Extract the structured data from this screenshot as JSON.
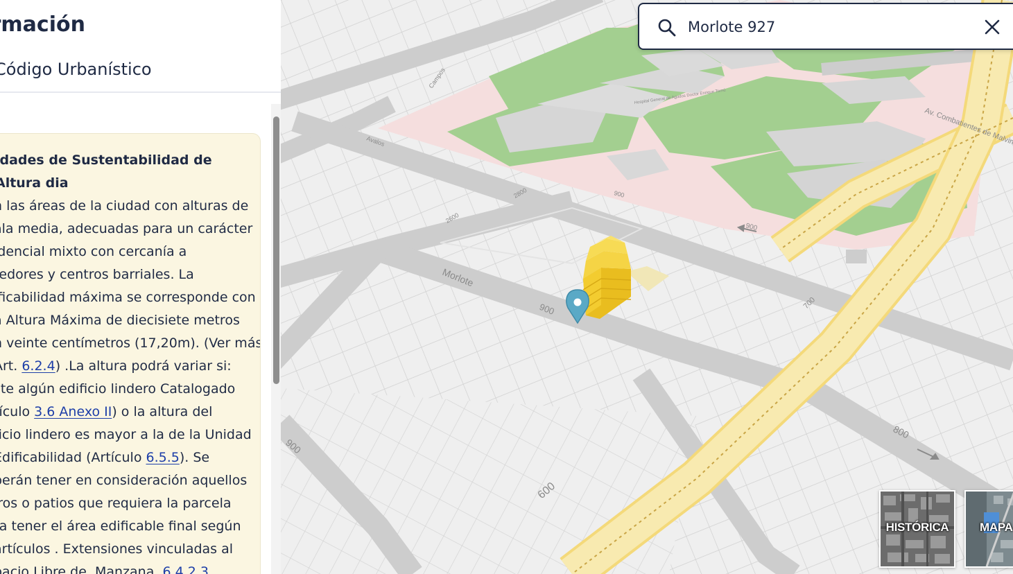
{
  "panel": {
    "title": "ormación",
    "subtitle": "Código Urbanístico",
    "card": {
      "heading": "idades de Sustentabilidad de Altura dia",
      "lines": [
        [
          "n las áreas de la ciudad con alturas de"
        ],
        [
          "ala media, adecuadas para un carácter"
        ],
        [
          "idencial mixto con cercanía a"
        ],
        [
          "redores y centros barriales. La"
        ],
        [
          "ificabilidad máxima se corresponde con"
        ],
        [
          "a Altura Máxima de diecisiete metros"
        ],
        [
          "n veinte centímetros (17,20m). (Ver más"
        ],
        [
          "Art. ",
          {
            "link": "6.2.4"
          },
          ") .La altura podrá variar si:"
        ],
        [
          "ste algún edificio lindero Catalogado"
        ],
        [
          "tículo ",
          {
            "link": "3.6 Anexo II"
          },
          ") o la altura del"
        ],
        [
          "ficio lindero es mayor a la de la Unidad"
        ],
        [
          " Edificabilidad (Artículo ",
          {
            "link": "6.5.5"
          },
          "). Se"
        ],
        [
          "berán tener en consideración aquellos"
        ],
        [
          "iros o patios que requiera la parcela"
        ],
        [
          "ra tener el área edificable final según"
        ],
        [
          " artículos . Extensiones vinculadas al"
        ],
        [
          "pacio Libre de .Manzana. ",
          {
            "link": "6.4.2.3"
          },
          "."
        ]
      ]
    }
  },
  "search": {
    "value": "Morlote 927",
    "placeholder": ""
  },
  "map": {
    "street_labels": {
      "morlote": "Morlote",
      "avalos": "Avalos",
      "campos": "Campos",
      "av_combatientes": "Av. Combatientes de Malvinas",
      "hospital": "Hospital General de Agudos Doctor Enrique Tornú"
    },
    "house_numbers": {
      "n900a": "900",
      "n900b": "900",
      "n900c": "900",
      "n900d": "900",
      "n2600": "2600",
      "n2800": "2800",
      "n700": "700",
      "n800": "800",
      "n600": "600"
    },
    "colors": {
      "park": "#a3cf90",
      "hospital": "#f5dcdc",
      "road": "#cdcdcd",
      "avenue": "#f7e7a4",
      "building": "#f1c522",
      "pin": "#5aa9c6"
    }
  },
  "basemaps": {
    "historica": "HISTÓRICA",
    "mapa": "MAPA"
  },
  "icons": {
    "search": "search-icon",
    "close": "close-icon",
    "pin": "location-pin-icon"
  }
}
